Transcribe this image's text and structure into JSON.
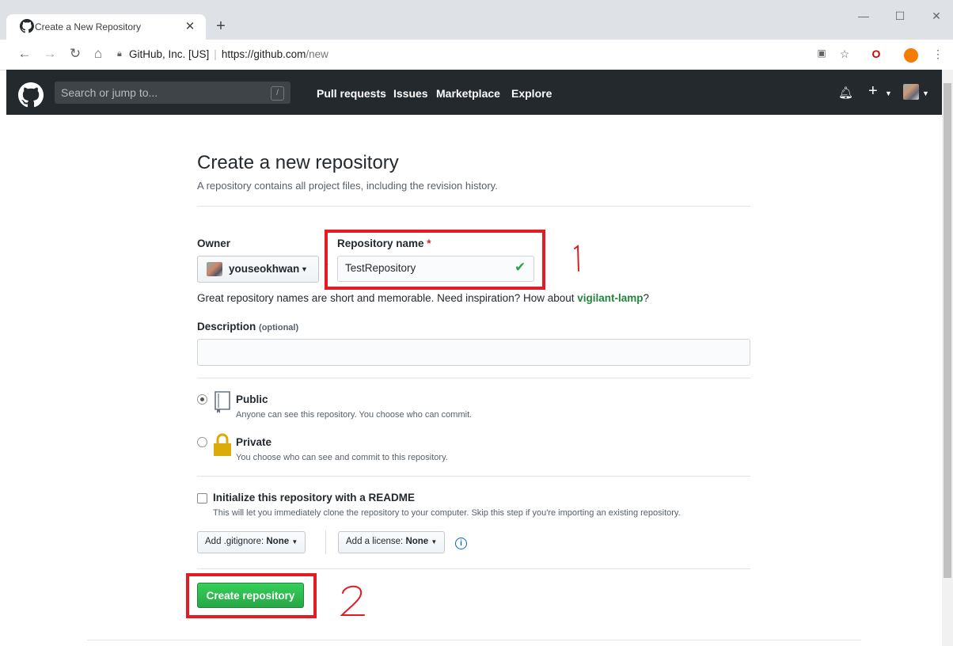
{
  "browser": {
    "tab_title": "Create a New Repository",
    "address_org": "GitHub, Inc. [US]",
    "address_host": "https://github.com",
    "address_path": "/new"
  },
  "github_header": {
    "search_placeholder": "Search or jump to...",
    "search_shortcut": "/",
    "nav": [
      "Pull requests",
      "Issues",
      "Marketplace",
      "Explore"
    ]
  },
  "page": {
    "title": "Create a new repository",
    "subtitle": "A repository contains all project files, including the revision history.",
    "owner_label": "Owner",
    "owner_value": "youseokhwan",
    "owner_separator": "/",
    "repo_name_label": "Repository name",
    "required_marker": "*",
    "repo_name_value": "TestRepository",
    "name_hint_prefix": "Great repository names are short and memorable. Need inspiration? How about ",
    "name_hint_suggestion": "vigilant-lamp",
    "name_hint_suffix": "?",
    "description_label": "Description",
    "description_optional": "(optional)",
    "description_value": "",
    "visibility": [
      {
        "label": "Public",
        "desc": "Anyone can see this repository. You choose who can commit.",
        "selected": true
      },
      {
        "label": "Private",
        "desc": "You choose who can see and commit to this repository.",
        "selected": false
      }
    ],
    "readme_label": "Initialize this repository with a README",
    "readme_checked": false,
    "readme_desc": "This will let you immediately clone the repository to your computer. Skip this step if you're importing an existing repository.",
    "gitignore_label": "Add .gitignore:",
    "gitignore_value": "None",
    "license_label": "Add a license:",
    "license_value": "None",
    "info_glyph": "i",
    "create_button": "Create repository"
  },
  "annotations": {
    "step1": "1",
    "step2": "2",
    "color": "#e31b23"
  },
  "colors": {
    "header_bg": "#24292e",
    "create_green": "#28a745",
    "suggestion_green": "#22863a"
  }
}
